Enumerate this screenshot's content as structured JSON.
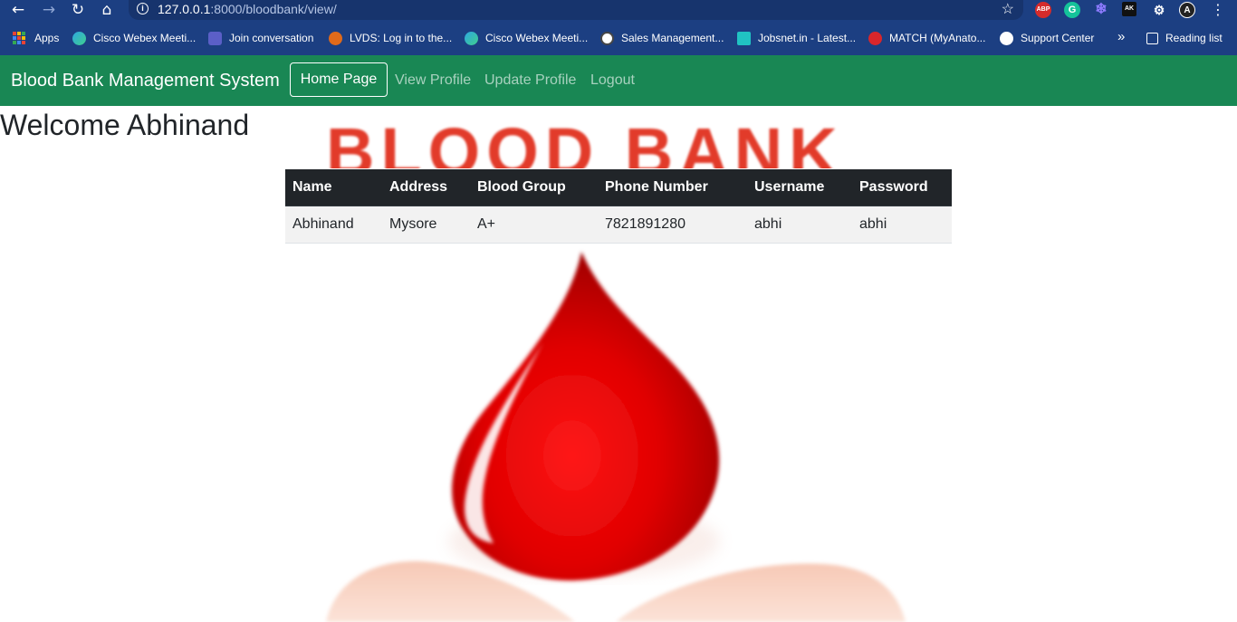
{
  "browser": {
    "url_host": "127.0.0.1",
    "url_rest": ":8000/bloodbank/view/",
    "extensions": [
      "ABP",
      "G",
      "AK"
    ],
    "bookmarks": [
      {
        "label": "Apps"
      },
      {
        "label": "Cisco Webex Meeti..."
      },
      {
        "label": "Join conversation"
      },
      {
        "label": "LVDS: Log in to the..."
      },
      {
        "label": "Cisco Webex Meeti..."
      },
      {
        "label": "Sales Management..."
      },
      {
        "label": "Jobsnet.in - Latest..."
      },
      {
        "label": "MATCH (MyAnato..."
      },
      {
        "label": "Support Center"
      }
    ],
    "more_label": "»",
    "reading_list": "Reading list"
  },
  "navbar": {
    "brand": "Blood Bank Management System",
    "links": {
      "home": "Home Page",
      "view": "View Profile",
      "update": "Update Profile",
      "logout": "Logout"
    }
  },
  "page": {
    "welcome": "Welcome Abhinand",
    "banner_text": "BLOOD BANK"
  },
  "profile_table": {
    "headers": [
      "Name",
      "Address",
      "Blood Group",
      "Phone Number",
      "Username",
      "Password"
    ],
    "row": [
      "Abhinand",
      "Mysore",
      "A+",
      "7821891280",
      "abhi",
      "abhi"
    ]
  },
  "colors": {
    "navbar_bg": "#198754",
    "browser_bg": "#1c3f82",
    "table_header_bg": "#212529",
    "drop_red": "#e00000"
  },
  "icons": [
    "back-arrow-icon",
    "forward-arrow-icon",
    "reload-icon",
    "home-icon",
    "site-info-icon",
    "bookmark-star-icon",
    "extensions-puzzle-icon",
    "kebab-menu-icon",
    "apps-grid-icon",
    "reading-list-icon"
  ]
}
